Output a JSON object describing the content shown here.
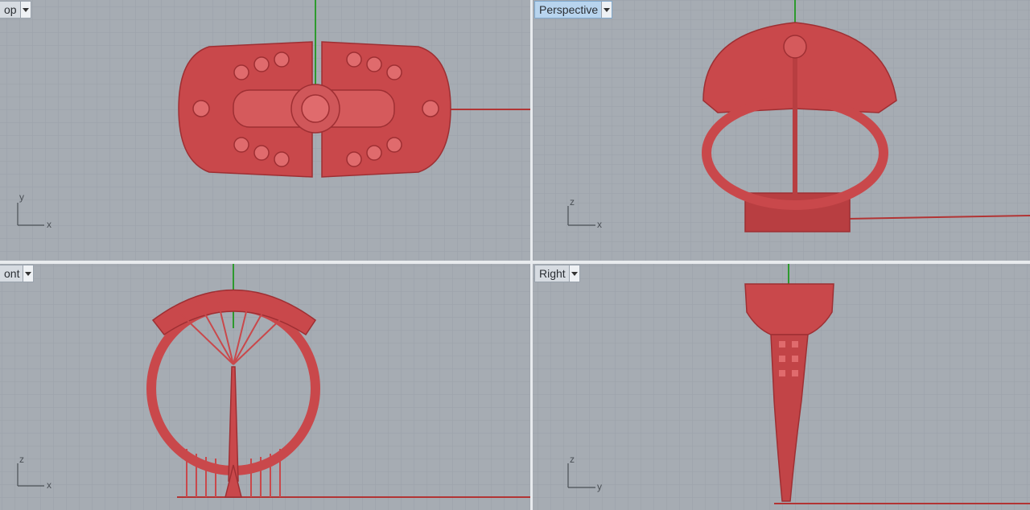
{
  "viewports": {
    "top": {
      "label": "op"
    },
    "perspective": {
      "label": "Perspective"
    },
    "front": {
      "label": "ont"
    },
    "right": {
      "label": "Right"
    }
  },
  "axes": {
    "top": {
      "a": "y",
      "b": "x"
    },
    "perspective": {
      "a": "z",
      "b": "x"
    },
    "front": {
      "a": "z",
      "b": "x"
    },
    "right": {
      "a": "z",
      "b": "y"
    }
  },
  "colors": {
    "model": "#c9484b",
    "viewport_bg": "#a6acb3",
    "grid_minor": "#9aa1a8",
    "grid_major": "#8d949b",
    "x_axis": "#b23434",
    "y_axis": "#2e9a2e",
    "active_tab": "#b8d4ee"
  },
  "icons": [
    "dropdown-arrow-icon",
    "axis-widget-icon"
  ]
}
